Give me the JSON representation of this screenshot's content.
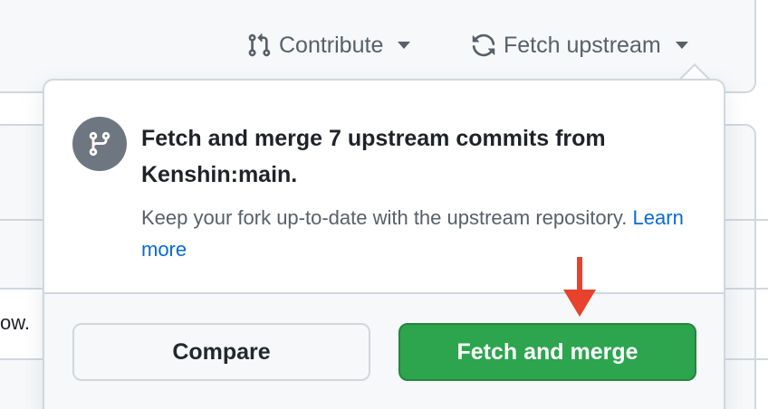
{
  "header": {
    "contribute_label": "Contribute",
    "fetch_label": "Fetch upstream"
  },
  "background": {
    "truncated_text": "ow."
  },
  "popover": {
    "title": "Fetch and merge 7 upstream commits from Kenshin:main.",
    "description": "Keep your fork up-to-date with the upstream repository.",
    "learn_more": "Learn more",
    "compare_label": "Compare",
    "merge_label": "Fetch and merge"
  },
  "colors": {
    "primary_green": "#2da44e",
    "link_blue": "#0969da",
    "annotation_red": "#e8412c"
  }
}
